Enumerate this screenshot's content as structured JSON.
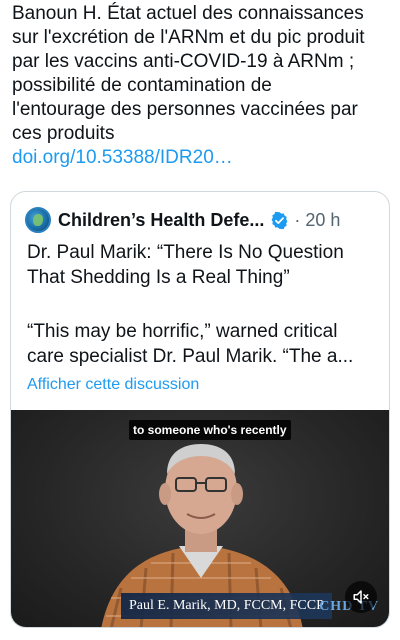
{
  "tweet": {
    "text_lines": [
      "Banoun H. État actuel des connaissances",
      "sur l'excrétion de l'ARNm et du pic produit",
      "par les vaccins anti-COVID-19 à ARNm ;",
      "possibilité de contamination de",
      "l'entourage des personnes vaccinées par",
      "ces produits"
    ],
    "link_text": "doi.org/10.53388/IDR20…"
  },
  "quote": {
    "author_name": "Children’s Health Defe...",
    "time": "· 20 h",
    "title_lines": [
      "Dr. Paul Marik: “There Is No Question",
      "That Shedding Is a Real Thing”"
    ],
    "excerpt_lines": [
      "“This may be horrific,” warned critical",
      "care specialist Dr. Paul Marik. “The a..."
    ],
    "show_thread_label": "Afficher cette discussion",
    "video": {
      "caption": "to someone who's recently",
      "lower_third": "Paul E. Marik, MD, FCCM, FCCP",
      "logo": "CHD TV",
      "mute_icon": "speaker-muted-icon"
    }
  },
  "colors": {
    "link": "#1d9bf0",
    "verified": "#1d9bf0",
    "secondary_text": "#536471",
    "border": "#cfd9de"
  }
}
